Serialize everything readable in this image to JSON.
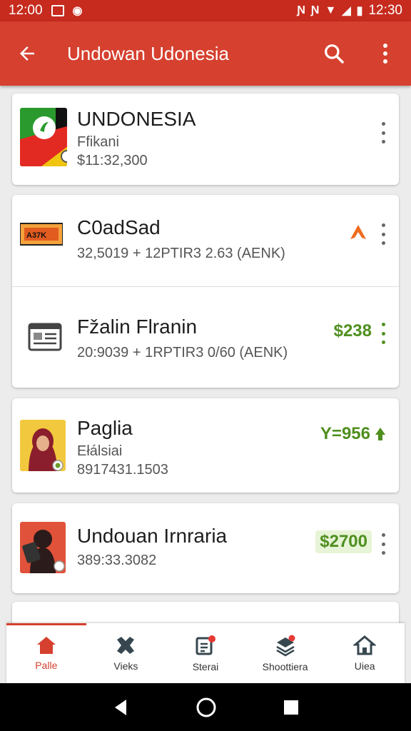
{
  "status_bar": {
    "time_left": "12:00",
    "time_right": "12:30"
  },
  "app_bar": {
    "title": "Undowan Udonesia"
  },
  "cards": [
    {
      "rows": [
        {
          "name": "UNDONESIA",
          "sub": "Ffikani",
          "meta": "$11:32,300",
          "amount": ""
        }
      ]
    },
    {
      "rows": [
        {
          "name": "C0adSad",
          "sub": "",
          "meta": "32,5019 + 12PTIR3 2.63 (AENK)",
          "amount": ""
        },
        {
          "name": "Fžalin Flranin",
          "sub": "",
          "meta": "20:9039 + 1RPTIR3 0/60 (AENK)",
          "amount": "$238"
        }
      ]
    },
    {
      "rows": [
        {
          "name": "Paglia",
          "sub": "Ełálsiai",
          "meta": "8917431.1503",
          "amount": "Y=956"
        }
      ]
    },
    {
      "rows": [
        {
          "name": "Undouan Irnraria",
          "sub": "",
          "meta": "389:33.3082",
          "amount": "$2700"
        }
      ]
    }
  ],
  "bottom_nav": [
    {
      "label": "Palle",
      "icon": "home-icon"
    },
    {
      "label": "Vieks",
      "icon": "puzzle-icon"
    },
    {
      "label": "Sterai",
      "icon": "document-icon"
    },
    {
      "label": "Shoottiera",
      "icon": "stack-icon"
    },
    {
      "label": "Uiea",
      "icon": "house-icon"
    }
  ],
  "colors": {
    "primary": "#d6402f",
    "status_bar": "#c62b1e",
    "positive": "#4f8f1f"
  }
}
